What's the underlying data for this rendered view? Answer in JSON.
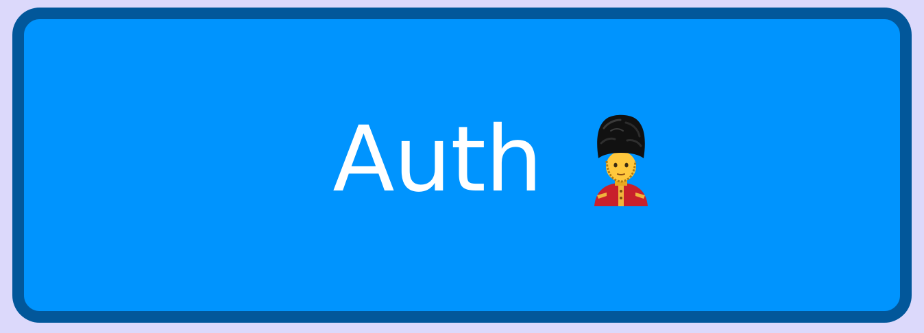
{
  "auth_button": {
    "label": "Auth",
    "icon": "guard-icon"
  },
  "colors": {
    "page_background": "#dcd9fb",
    "card_fill": "#0094fe",
    "card_border": "#02579a",
    "label_text": "#ffffff"
  }
}
